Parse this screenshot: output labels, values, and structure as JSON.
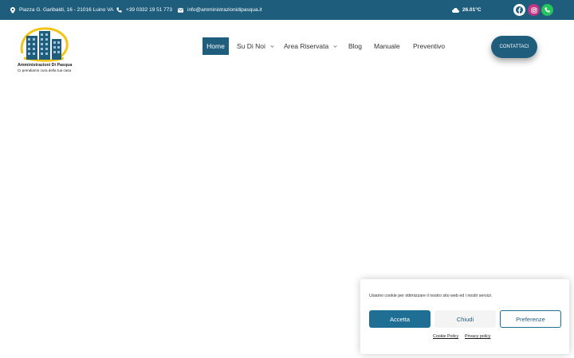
{
  "topbar": {
    "address": "Piazza G. Garibaldi, 16 - 21016 Luino VA",
    "phone": "+39 0332 19 51 773",
    "email": "info@amministrazionidipasqua.it",
    "weather": "26.01°C",
    "weather_icon": "cloud-icon",
    "social": [
      "facebook-icon",
      "instagram-icon",
      "whatsapp-phone-icon"
    ],
    "colors": {
      "bar": "#1f5d7d",
      "facebook": "#ffffff",
      "instagram": "#c13584",
      "whatsapp": "#25c45e"
    }
  },
  "logo": {
    "name": "Amministrazioni Di Pasqua",
    "tagline": "Ci prendiamo cura della tua casa",
    "colors": {
      "buildings": "#1f5d7d",
      "arc": "#f2c417"
    }
  },
  "nav": {
    "items": [
      {
        "label": "Home",
        "active": true
      },
      {
        "label": "Su Di Noi",
        "dropdown": true
      },
      {
        "label": "Area Riservata",
        "dropdown": true
      },
      {
        "label": "Blog"
      },
      {
        "label": "Manuale"
      },
      {
        "label": "Preventivo"
      }
    ],
    "cta": "CONTATTACI",
    "accent": "#1f5d7d"
  },
  "cookie": {
    "message": "Usiamo cookie per ottimizzare il nostro sito web ed i nostri servizi.",
    "accept": "Accetta",
    "close": "Chiudi",
    "preferences": "Preferenze",
    "cookie_policy": "Cookie Policy",
    "privacy_policy": "Privacy policy"
  }
}
